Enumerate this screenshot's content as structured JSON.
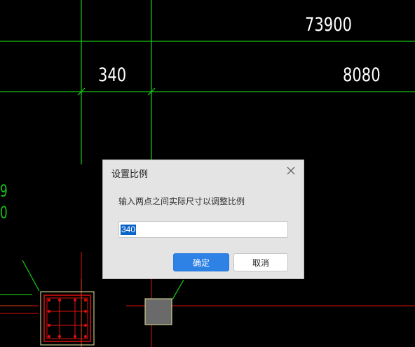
{
  "drawing": {
    "dimensions": [
      "73900",
      "340",
      "8080"
    ],
    "side_labels": [
      "9",
      "0"
    ],
    "colors": {
      "axis_line": "#18c018",
      "rebar": "#e01010",
      "column_outline": "#e8e8a0",
      "background": "#000000"
    }
  },
  "dialog": {
    "title": "设置比例",
    "message": "输入两点之间实际尺寸以调整比例",
    "input_value": "340",
    "ok_label": "确定",
    "cancel_label": "取消",
    "close_icon": "close-icon"
  }
}
